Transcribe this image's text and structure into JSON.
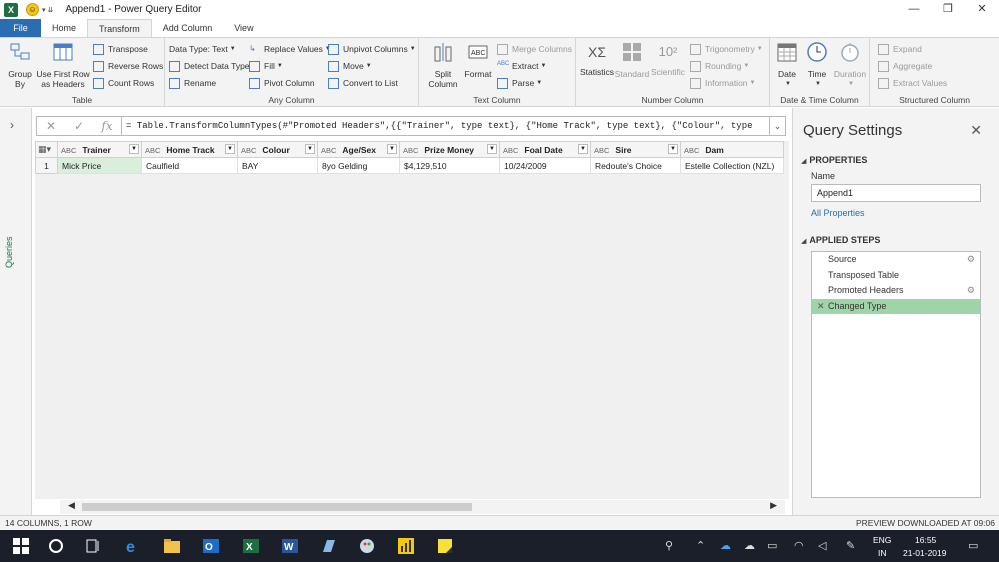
{
  "window": {
    "title": "Append1 - Power Query Editor",
    "app_badge": "X",
    "controls": [
      "—",
      "❐",
      "✕"
    ]
  },
  "tabs": [
    "File",
    "Home",
    "Transform",
    "Add Column",
    "View"
  ],
  "active_tab": "Transform",
  "ribbon": {
    "table_group": {
      "label": "Table",
      "group_by": "Group By",
      "use_first_row": "Use First Row as Headers",
      "transpose": "Transpose",
      "reverse_rows": "Reverse Rows",
      "count_rows": "Count Rows"
    },
    "any_column_group": {
      "label": "Any Column",
      "data_type": "Data Type: Text",
      "detect_data_type": "Detect Data Type",
      "rename": "Rename",
      "replace_values": "Replace Values",
      "fill": "Fill",
      "pivot_column": "Pivot Column",
      "unpivot_columns": "Unpivot Columns",
      "move": "Move",
      "convert_to_list": "Convert to List"
    },
    "text_column_group": {
      "label": "Text Column",
      "split_column": "Split Column",
      "format": "Format",
      "merge_columns": "Merge Columns",
      "extract": "Extract",
      "parse": "Parse"
    },
    "number_column_group": {
      "label": "Number Column",
      "statistics": "Statistics",
      "standard": "Standard",
      "scientific": "Scientific",
      "trigonometry": "Trigonometry",
      "rounding": "Rounding",
      "information": "Information"
    },
    "datetime_group": {
      "label": "Date & Time Column",
      "date": "Date",
      "time": "Time",
      "duration": "Duration"
    },
    "structured_group": {
      "label": "Structured Column",
      "expand": "Expand",
      "aggregate": "Aggregate",
      "extract_values": "Extract Values"
    }
  },
  "left_nav": {
    "label": "Queries"
  },
  "formula_bar": {
    "cancel": "✕",
    "commit": "✓",
    "fx": "fx",
    "formula": "= Table.TransformColumnTypes(#\"Promoted Headers\",{{\"Trainer\", type text}, {\"Home Track\", type text}, {\"Colour\", type"
  },
  "grid": {
    "columns": [
      {
        "type": "ABC",
        "name": "Trainer"
      },
      {
        "type": "ABC",
        "name": "Home Track"
      },
      {
        "type": "ABC",
        "name": "Colour"
      },
      {
        "type": "ABC",
        "name": "Age/Sex"
      },
      {
        "type": "ABC",
        "name": "Prize Money"
      },
      {
        "type": "ABC",
        "name": "Foal Date"
      },
      {
        "type": "ABC",
        "name": "Sire"
      },
      {
        "type": "ABC",
        "name": "Dam"
      }
    ],
    "rows": [
      {
        "index": "1",
        "cells": [
          "Mick Price",
          "Caulfield",
          "BAY",
          "8yo Gelding",
          "$4,129,510",
          "10/24/2009",
          "Redoute's Choice",
          "Estelle Collection (NZL)"
        ]
      }
    ]
  },
  "query_settings": {
    "title": "Query Settings",
    "properties_label": "PROPERTIES",
    "name_label": "Name",
    "name_value": "Append1",
    "all_properties": "All Properties",
    "applied_steps_label": "APPLIED STEPS",
    "steps": [
      {
        "label": "Source",
        "gear": true
      },
      {
        "label": "Transposed Table",
        "gear": false
      },
      {
        "label": "Promoted Headers",
        "gear": true
      },
      {
        "label": "Changed Type",
        "gear": false,
        "active": true
      }
    ]
  },
  "status": {
    "left": "14 COLUMNS, 1 ROW",
    "right": "PREVIEW DOWNLOADED AT 09:06"
  },
  "taskbar": {
    "lang": "ENG",
    "region": "IN",
    "time": "16:55",
    "date": "21-01-2019"
  },
  "colors": {
    "accent_green": "#1d6f42",
    "file_tab_blue": "#2b6cb3",
    "active_step": "#9fd4a8",
    "selected_cell": "#d9efdc"
  }
}
